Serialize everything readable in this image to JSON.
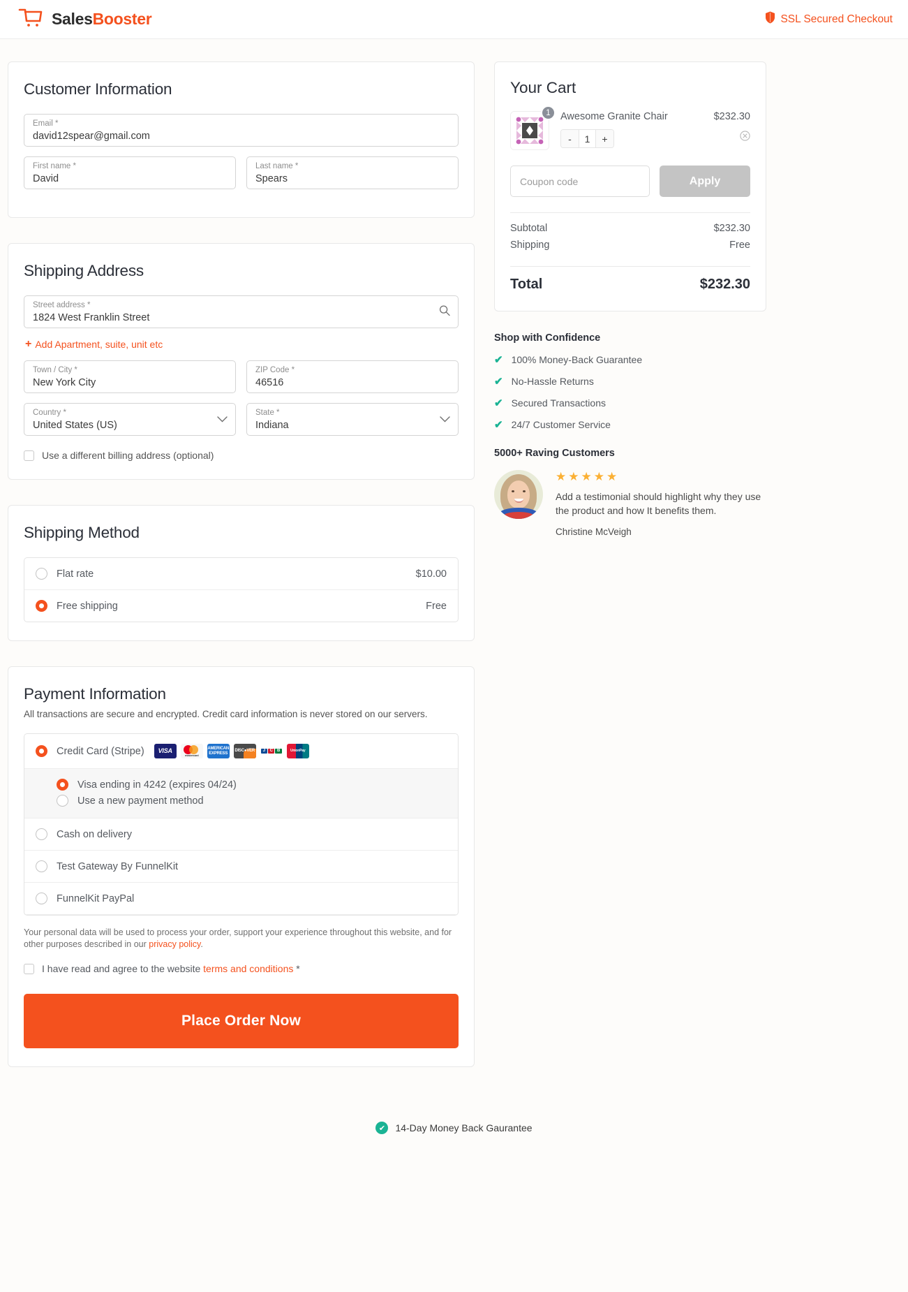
{
  "header": {
    "brand_first": "Sales",
    "brand_second": "Booster",
    "cart_icon": "shopping-cart-icon",
    "ssl_text": "SSL Secured Checkout",
    "ssl_icon": "shield-icon",
    "accent_color": "#f4511e"
  },
  "customer": {
    "title": "Customer Information",
    "email": {
      "label": "Email *",
      "value": "david12spear@gmail.com"
    },
    "first_name": {
      "label": "First name *",
      "value": "David"
    },
    "last_name": {
      "label": "Last name *",
      "value": "Spears"
    }
  },
  "shipping_address": {
    "title": "Shipping Address",
    "street": {
      "label": "Street address *",
      "value": "1824 West Franklin Street"
    },
    "add_apartment": "Add Apartment, suite, unit etc",
    "city": {
      "label": "Town / City *",
      "value": "New York City"
    },
    "zip": {
      "label": "ZIP Code *",
      "value": "46516"
    },
    "country": {
      "label": "Country *",
      "value": "United States (US)"
    },
    "state": {
      "label": "State *",
      "value": "Indiana"
    },
    "billing_checkbox": "Use a different billing address (optional)"
  },
  "shipping_method": {
    "title": "Shipping Method",
    "options": [
      {
        "label": "Flat rate",
        "amount": "$10.00",
        "selected": false
      },
      {
        "label": "Free shipping",
        "amount": "Free",
        "selected": true
      }
    ]
  },
  "payment": {
    "title": "Payment Information",
    "subtitle": "All transactions are secure and encrypted. Credit card information is never stored on our servers.",
    "stripe_label": "Credit Card (Stripe)",
    "card_brands": [
      "VISA",
      "mastercard",
      "AMERICAN EXPRESS",
      "DISCOVER",
      "JCB",
      "UnionPay"
    ],
    "saved_cards": [
      {
        "label": "Visa ending in 4242 (expires 04/24)",
        "selected": true
      },
      {
        "label": "Use a new payment method",
        "selected": false
      }
    ],
    "other_methods": [
      {
        "label": "Cash on delivery",
        "selected": false
      },
      {
        "label": "Test Gateway By FunnelKit",
        "selected": false
      },
      {
        "label": "FunnelKit PayPal",
        "selected": false
      }
    ],
    "legal_pre": "Your personal data will be used to process your order, support your experience throughout this website, and for other purposes described in our ",
    "legal_link": "privacy policy",
    "legal_post": ".",
    "terms_pre": "I have read and agree to the website ",
    "terms_link": "terms and conditions",
    "terms_post": " *",
    "place_order": "Place Order Now"
  },
  "cart": {
    "title": "Your Cart",
    "item": {
      "name": "Awesome Granite Chair",
      "price": "$232.30",
      "quantity": "1",
      "badge": "1",
      "minus": "-",
      "plus": "+",
      "remove_icon": "remove-circle-icon"
    },
    "coupon_placeholder": "Coupon code",
    "apply_label": "Apply",
    "subtotal_label": "Subtotal",
    "subtotal_value": "$232.30",
    "shipping_label": "Shipping",
    "shipping_value": "Free",
    "total_label": "Total",
    "total_value": "$232.30"
  },
  "trust": {
    "title": "Shop with Confidence",
    "items": [
      "100% Money-Back Guarantee",
      "No-Hassle Returns",
      "Secured Transactions",
      "24/7 Customer Service"
    ],
    "tick_color": "#1ab394"
  },
  "testimonial": {
    "title": "5000+ Raving Customers",
    "stars": "★★★★★",
    "text": "Add a testimonial should highlight why they use the product and how It benefits them.",
    "name": "Christine McVeigh"
  },
  "footer": {
    "badge_text": "14-Day Money Back Gaurantee",
    "badge_icon": "check-circle-icon"
  }
}
